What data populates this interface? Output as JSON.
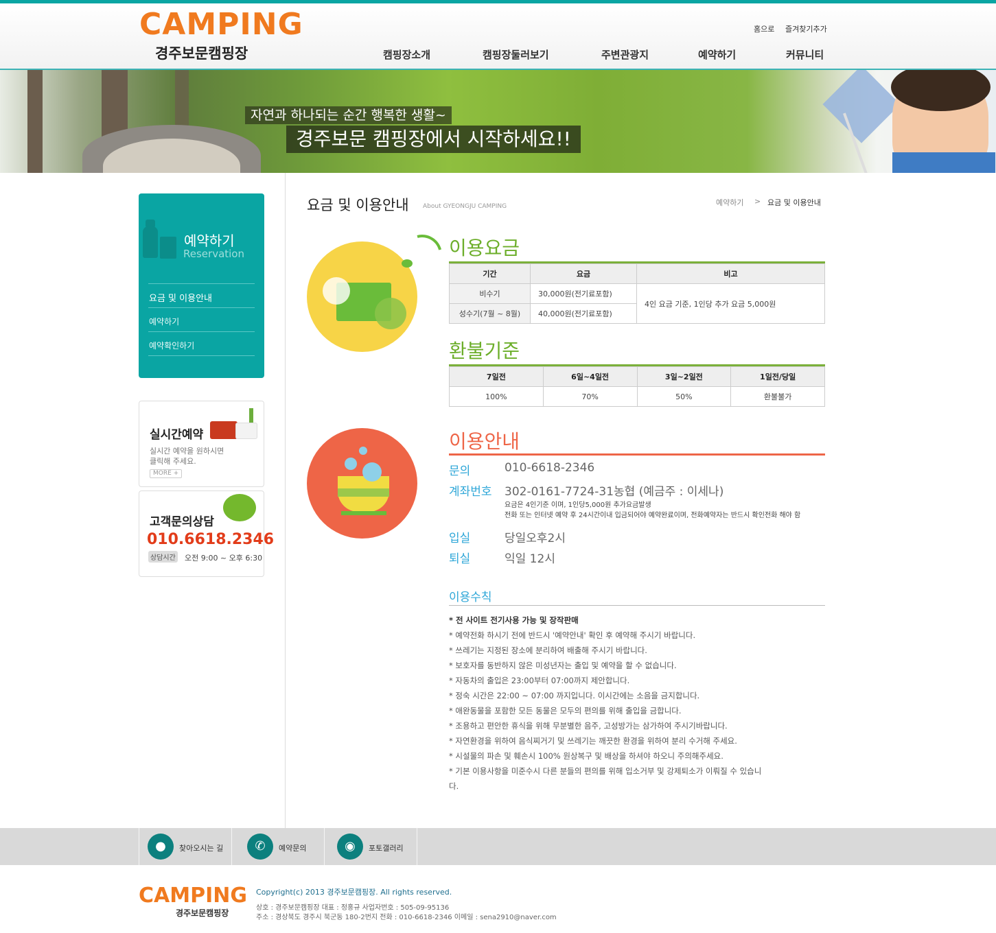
{
  "header": {
    "logo_main": "CAMPING",
    "logo_sub": "경주보문캠핑장",
    "util_links": [
      "홈으로",
      "즐겨찾기추가"
    ],
    "nav": [
      "캠핑장소개",
      "캠핑장둘러보기",
      "주변관광지",
      "예약하기",
      "커뮤니티"
    ]
  },
  "banner": {
    "line1": "자연과 하나되는 순간 행복한 생활~",
    "line2": "경주보문 캠핑장에서 시작하세요!!"
  },
  "sidebar": {
    "title": "예약하기",
    "subtitle": "Reservation",
    "items": [
      "요금 및 이용안내",
      "예약하기",
      "예약확인하기"
    ],
    "realtime": {
      "title": "실시간예약",
      "desc1": "실시간 예약을 원하시면",
      "desc2": "클릭해 주세요.",
      "more": "MORE +"
    },
    "contact": {
      "title": "고객문의상담",
      "phone": "010.6618.2346",
      "badge": "상담시간",
      "hours": "오전 9:00 ~ 오후 6:30"
    }
  },
  "page": {
    "title": "요금 및 이용안내",
    "title_en": "About GYEONGJU CAMPING",
    "breadcrumb": [
      "예약하기",
      ">",
      "요금 및 이용안내"
    ]
  },
  "fees": {
    "title": "이용요금",
    "headers": [
      "기간",
      "요금",
      "비고"
    ],
    "rows": [
      {
        "period": "비수기",
        "price": "30,000원(전기료포함)"
      },
      {
        "period": "성수기(7월 ~ 8월)",
        "price": "40,000원(전기료포함)"
      }
    ],
    "note": "4인 요금 기준, 1인당 추가 요금 5,000원"
  },
  "refund": {
    "title": "환불기준",
    "headers": [
      "7일전",
      "6일~4일전",
      "3일~2일전",
      "1일전/당일"
    ],
    "values": [
      "100%",
      "70%",
      "50%",
      "환불불가"
    ]
  },
  "info": {
    "title": "이용안내",
    "inquiry_label": "문의",
    "inquiry_value": "010-6618-2346",
    "account_label": "계좌번호",
    "account_value": "302-0161-7724-31농협 (예금주 : 이세나)",
    "note1": "요금은 4인기준 이며, 1인당5,000원 추가요금발생",
    "note2": "전화 또는 인터넷 예약 후 24시간이내 입금되어야 예약완료이며, 전화예약자는 반드시 확인전화 해야 함",
    "checkin_label": "입실",
    "checkin_value": "당일오후2시",
    "checkout_label": "퇴실",
    "checkout_value": "익일 12시"
  },
  "rules": {
    "title": "이용수칙",
    "items": [
      "* 전 사이트 전기사용 가능 및 장작판매",
      "* 예약전화 하시기 전에 반드시 '예약안내' 확인 후 예약해 주시기 바랍니다.",
      "* 쓰레기는 지정된 장소에 분리하여 배출해 주시기 바랍니다.",
      "* 보호자를 동반하지 않은 미성년자는 출입 및 예약을 할 수 없습니다.",
      "* 자동차의 출입은 23:00부터 07:00까지 제안합니다.",
      "* 정숙 시간은 22:00 ~ 07:00 까지입니다. 이시간에는 소음을 금지합니다.",
      "* 애완동물을 포함한 모든 동물은 모두의 편의를 위해 출입을 금합니다.",
      "* 조용하고 편안한 휴식을 위해 무분별한 음주, 고성방가는 삼가하여 주시기바랍니다.",
      "* 자연환경을 위하여 음식찌거기 및 쓰레기는 깨끗한 환경을 위하여 분리 수거해 주세요.",
      "* 시설물의 파손 및 훼손시 100% 원상복구 및 배상을 하셔야 하오니 주의해주세요.",
      "* 기본 이용사항을 미준수시 다른 분들의 편의를 위해 입소거부 및 강제퇴소가 이뤄질 수 있습니",
      "다."
    ]
  },
  "footer": {
    "links": [
      "찾아오시는 길",
      "예약문의",
      "포토갤러리"
    ],
    "logo_main": "CAMPING",
    "logo_sub": "경주보문캠핑장",
    "copyright": "Copyright(c) 2013 경주보문캠핑장. All rights reserved.",
    "line1": "상호 : 경주보문캠핑장    대표 : 정홍규    사업자번호 : 505-09-95136",
    "line2": "주소 : 경상북도 경주시 북군동 180-2번지    전화 : 010-6618-2346    이메일 : sena2910@naver.com"
  }
}
